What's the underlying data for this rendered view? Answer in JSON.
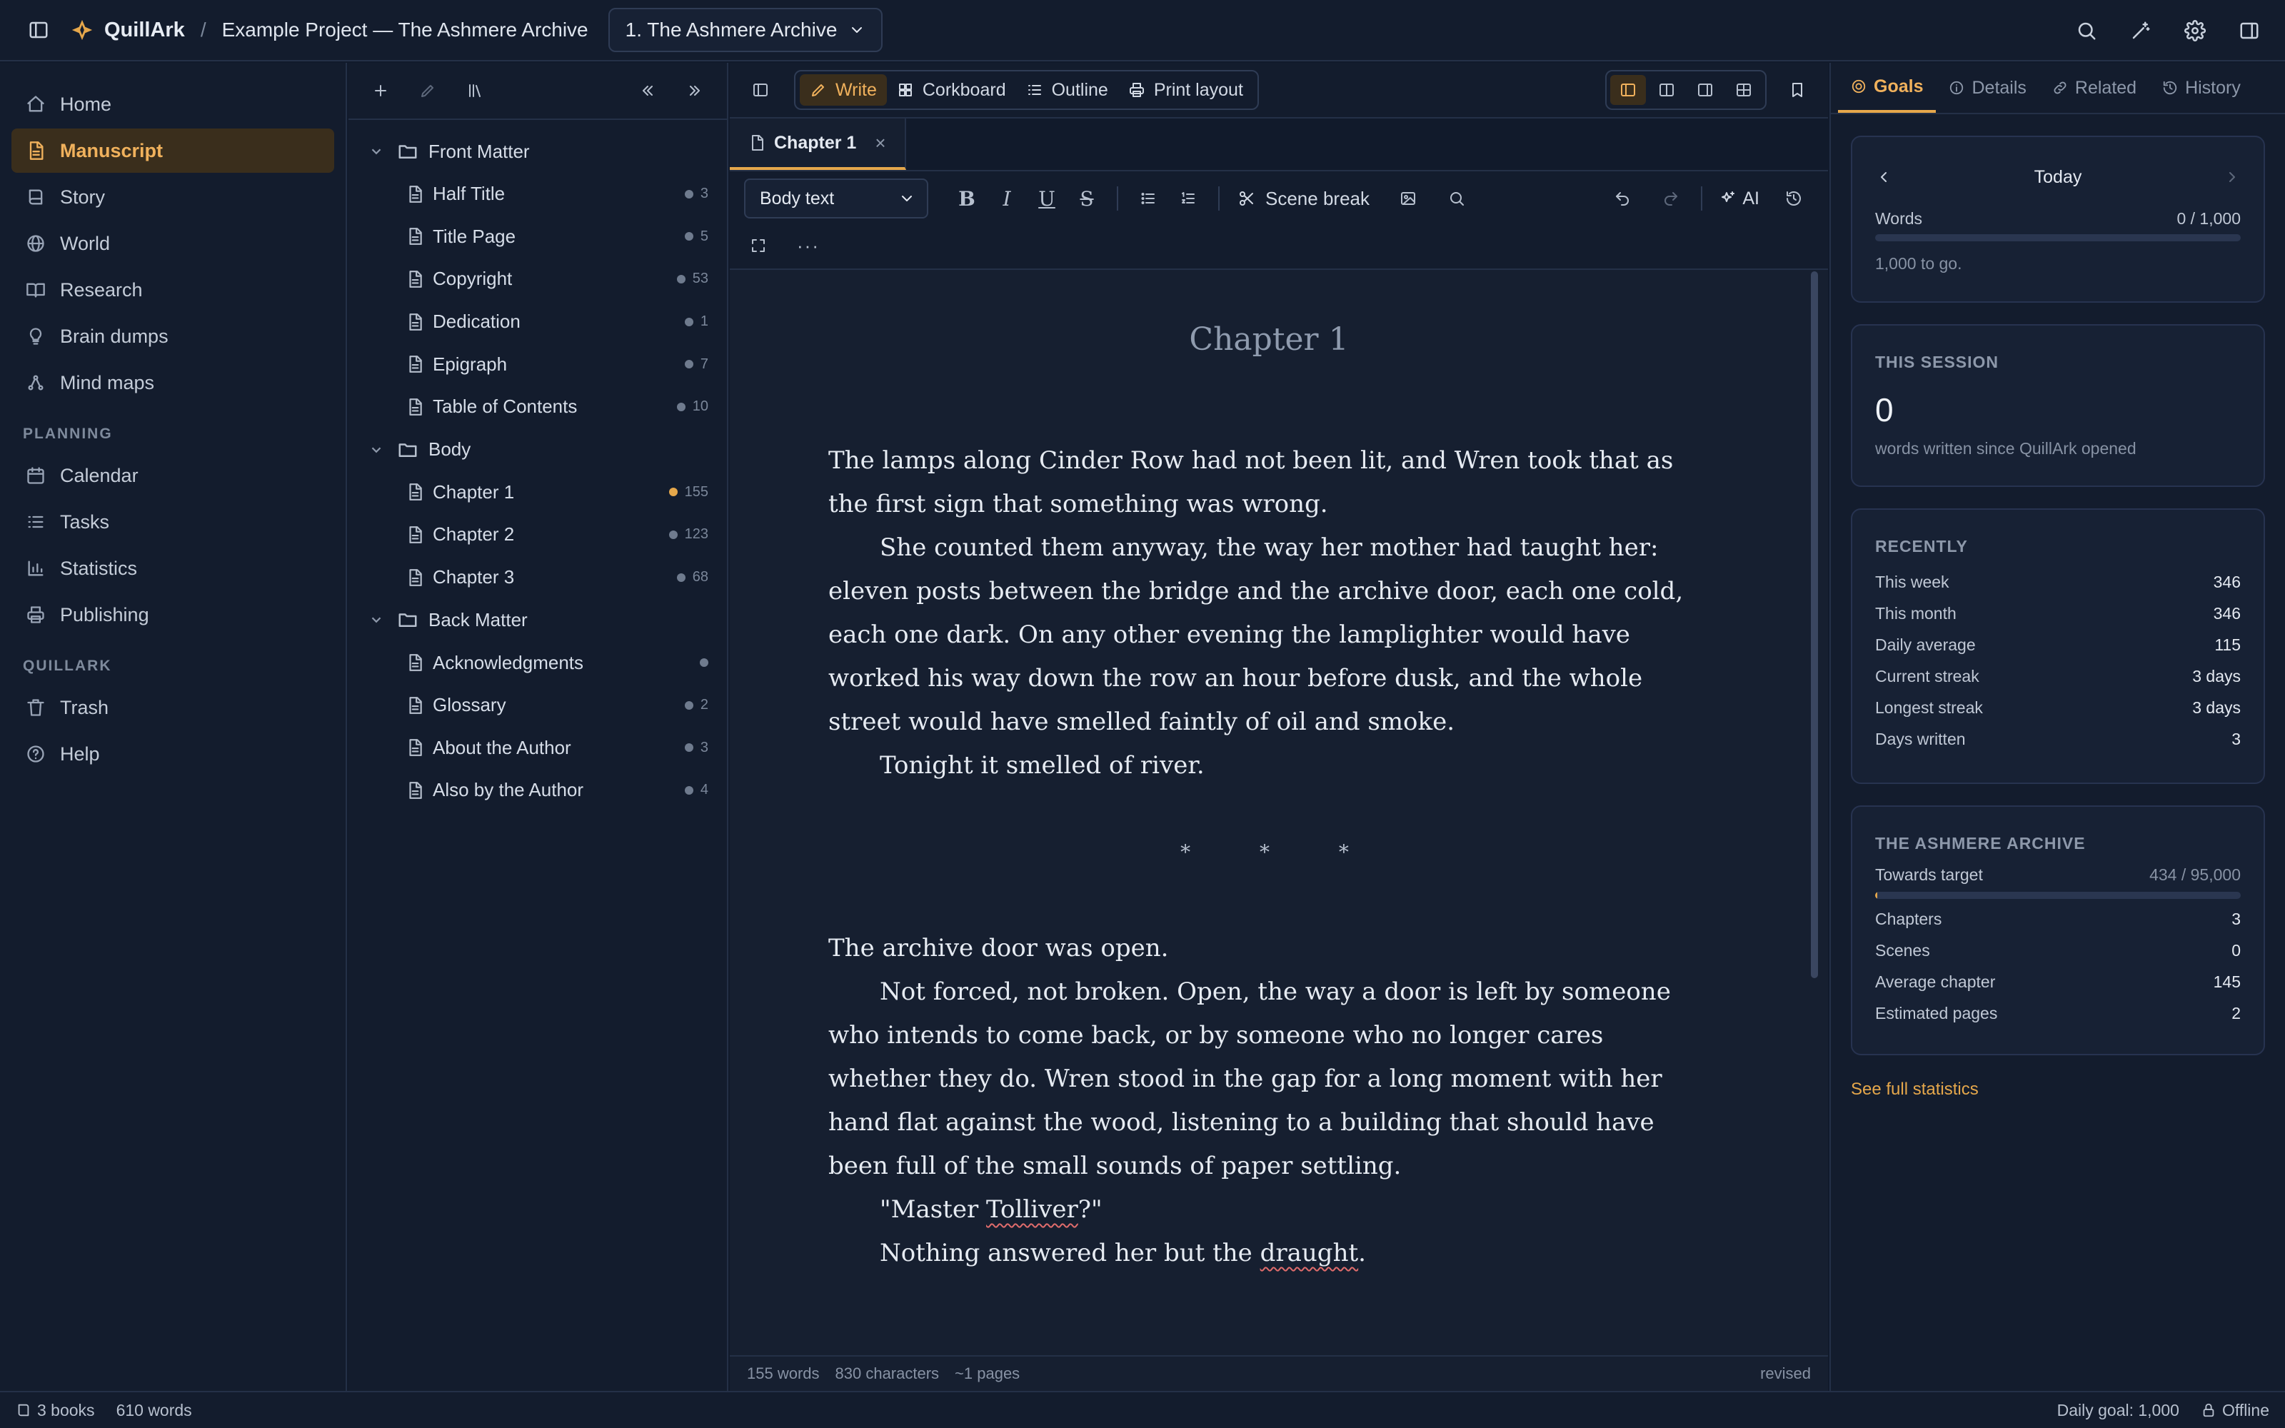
{
  "app": {
    "name": "QuillArk",
    "crumb_sep": "/",
    "project": "Example Project — The Ashmere Archive",
    "book_select": "1. The Ashmere Archive",
    "accent": "#e5a74b",
    "background": "#111a2b"
  },
  "nav": {
    "items": [
      {
        "label": "Home",
        "icon": "home-icon"
      },
      {
        "label": "Manuscript",
        "icon": "document-icon"
      },
      {
        "label": "Story",
        "icon": "book-icon"
      },
      {
        "label": "World",
        "icon": "globe-icon"
      },
      {
        "label": "Research",
        "icon": "book-open-icon"
      },
      {
        "label": "Brain dumps",
        "icon": "lightbulb-icon"
      },
      {
        "label": "Mind maps",
        "icon": "network-icon"
      }
    ],
    "planning_label": "PLANNING",
    "planning": [
      {
        "label": "Calendar",
        "icon": "calendar-icon"
      },
      {
        "label": "Tasks",
        "icon": "list-icon"
      },
      {
        "label": "Statistics",
        "icon": "bar-chart-icon"
      },
      {
        "label": "Publishing",
        "icon": "printer-icon"
      }
    ],
    "quillark_label": "QUILLARK",
    "quillark": [
      {
        "label": "Trash",
        "icon": "trash-icon"
      },
      {
        "label": "Help",
        "icon": "help-icon"
      }
    ]
  },
  "tree": {
    "front_matter": "Front Matter",
    "front_items": [
      {
        "name": "Half Title",
        "count": "3"
      },
      {
        "name": "Title Page",
        "count": "5"
      },
      {
        "name": "Copyright",
        "count": "53"
      },
      {
        "name": "Dedication",
        "count": "1"
      },
      {
        "name": "Epigraph",
        "count": "7"
      },
      {
        "name": "Table of Contents",
        "count": "10"
      }
    ],
    "body": "Body",
    "body_items": [
      {
        "name": "Chapter 1",
        "count": "155"
      },
      {
        "name": "Chapter 2",
        "count": "123"
      },
      {
        "name": "Chapter 3",
        "count": "68"
      }
    ],
    "back_matter": "Back Matter",
    "back_items": [
      {
        "name": "Acknowledgments",
        "count": ""
      },
      {
        "name": "Glossary",
        "count": "2"
      },
      {
        "name": "About the Author",
        "count": "3"
      },
      {
        "name": "Also by the Author",
        "count": "4"
      }
    ]
  },
  "editor": {
    "modes": [
      "Write",
      "Corkboard",
      "Outline",
      "Print layout"
    ],
    "tab_label": "Chapter 1",
    "tab_close": "×",
    "style_select": "Body text",
    "scene_break_label": "Scene break",
    "ai_label": "AI",
    "more": "···",
    "chapter_title": "Chapter 1",
    "para1": "The lamps along Cinder Row had not been lit, and Wren took that as the first sign that something was wrong.",
    "para2": "She counted them anyway, the way her mother had taught her: eleven posts between the bridge and the archive door, each one cold, each one dark. On any other evening the lamplighter would have worked his way down the row an hour before dusk, and the whole street would have smelled faintly of oil and smoke.",
    "para3": "Tonight it smelled of river.",
    "scene_break": "* * *",
    "para4": "The archive door was open.",
    "para5": "Not forced, not broken. Open, the way a door is left by someone who intends to come back, or by someone who no longer cares whether they do. Wren stood in the gap for a long moment with her hand flat against the wood, listening to a building that should have been full of the small sounds of paper settling.",
    "para6_pre": "\"Master ",
    "para6_word": "Tolliver",
    "para6_post": "?\"",
    "para7_pre": "Nothing answered her but the ",
    "para7_word": "draught",
    "para7_post": ".",
    "status_words": "155 words",
    "status_chars": "830 characters",
    "status_pages": "~1 pages",
    "status_rev": "revised"
  },
  "right": {
    "tabs": [
      "Goals",
      "Details",
      "Related",
      "History"
    ],
    "goals": {
      "period": "Today",
      "words_label": "Words",
      "words_value": "0 / 1,000",
      "words_progress": 0,
      "to_go": "1,000 to go."
    },
    "session": {
      "title": "THIS SESSION",
      "value": "0",
      "caption": "words written since QuillArk opened"
    },
    "recently": {
      "title": "RECENTLY",
      "rows": [
        {
          "label": "This week",
          "value": "346"
        },
        {
          "label": "This month",
          "value": "346"
        },
        {
          "label": "Daily average",
          "value": "115"
        },
        {
          "label": "Current streak",
          "value": "3 days"
        },
        {
          "label": "Longest streak",
          "value": "3 days"
        },
        {
          "label": "Days written",
          "value": "3"
        }
      ]
    },
    "book": {
      "title": "THE ASHMERE ARCHIVE",
      "target_label": "Towards target",
      "target_value": "434 / 95,000",
      "target_progress": 0.005,
      "rows": [
        {
          "label": "Chapters",
          "value": "3"
        },
        {
          "label": "Scenes",
          "value": "0"
        },
        {
          "label": "Average chapter",
          "value": "145"
        },
        {
          "label": "Estimated pages",
          "value": "2"
        }
      ]
    },
    "see_full": "See full statistics"
  },
  "footer": {
    "books": "3 books",
    "words": "610 words",
    "daily_goal": "Daily goal: 1,000",
    "offline": "Offline"
  }
}
